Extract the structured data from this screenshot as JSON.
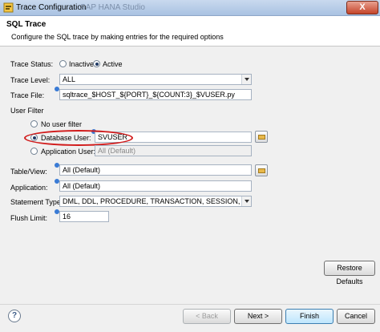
{
  "window": {
    "title": "Trace Configuration",
    "background_title": "SAP HANA Studio",
    "close_glyph": "X"
  },
  "header": {
    "title": "SQL Trace",
    "description": "Configure the SQL trace by making entries for the required options"
  },
  "trace_status": {
    "label": "Trace Status:",
    "options": [
      "Inactive",
      "Active"
    ],
    "selected": "Active"
  },
  "trace_level": {
    "label": "Trace Level:",
    "value": "ALL"
  },
  "trace_file": {
    "label": "Trace File:",
    "value": "sqltrace_$HOST_${PORT}_${COUNT:3}_$VUSER.py"
  },
  "user_filter": {
    "label": "User Filter",
    "no_user_label": "No user filter",
    "database_user_label": "Database User:",
    "database_user_value": "SVUSER",
    "application_user_label": "Application User:",
    "application_user_value": "All (Default)",
    "selected": "Database User"
  },
  "table_view": {
    "label": "Table/View:",
    "value": "All (Default)"
  },
  "application": {
    "label": "Application:",
    "value": "All (Default)"
  },
  "statement_type": {
    "label": "Statement Type:",
    "value": "DML, DDL, PROCEDURE, TRANSACTION, SESSION, SYSTEM"
  },
  "flush_limit": {
    "label": "Flush Limit:",
    "value": "16"
  },
  "buttons": {
    "restore_defaults": "Restore Defaults",
    "help": "?",
    "back": "< Back",
    "next": "Next >",
    "finish": "Finish",
    "cancel": "Cancel"
  },
  "colors": {
    "highlight_ellipse": "#d11a1a",
    "title_bar": "#b8cde8",
    "close_button": "#c5452a"
  }
}
